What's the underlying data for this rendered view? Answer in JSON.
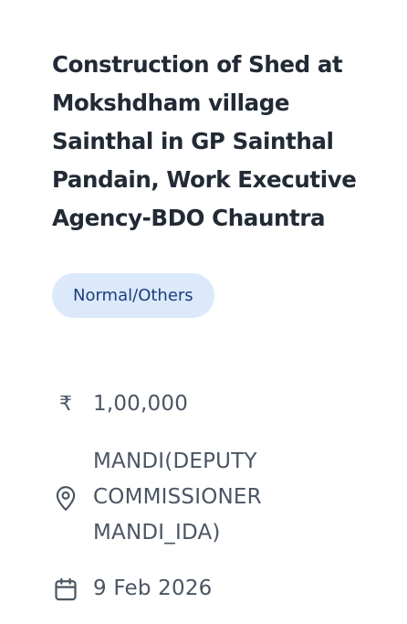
{
  "tender": {
    "title": "Construction of Shed at Mokshdham village Sainthal in GP Sainthal Pandain, Work Executive Agency-BDO Chauntra",
    "category_badge": "Normal/Others",
    "amount": "1,00,000",
    "amount_icon": "rupee-icon",
    "location_lines": [
      "MANDI(DEPUTY",
      "COMMISSIONER",
      "MANDI_IDA)"
    ],
    "location_icon": "location-pin-icon",
    "date": "9 Feb 2026",
    "date_icon": "calendar-icon"
  },
  "colors": {
    "title": "#222a35",
    "badge_bg": "#dce9fb",
    "badge_text": "#1c3f7a",
    "meta_text": "#4b5563"
  }
}
